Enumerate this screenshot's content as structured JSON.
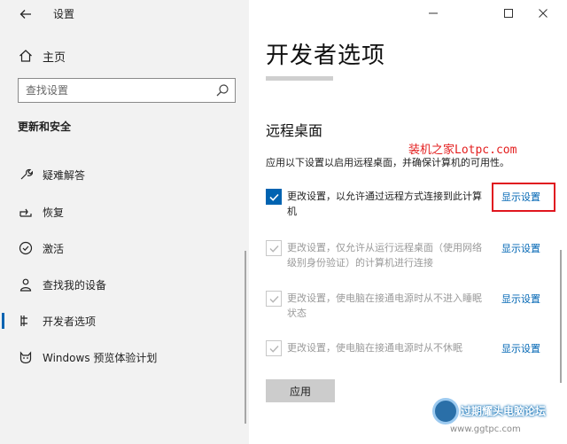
{
  "window": {
    "title": "设置",
    "back_icon": "arrow-left-icon",
    "controls": [
      "minimize-icon",
      "maximize-icon",
      "close-icon"
    ]
  },
  "sidebar": {
    "home_label": "主页",
    "search_placeholder": "查找设置",
    "section_title": "更新和安全",
    "items": [
      {
        "label": "疑难解答",
        "icon": "wrench-icon",
        "active": false
      },
      {
        "label": "恢复",
        "icon": "recovery-icon",
        "active": false
      },
      {
        "label": "激活",
        "icon": "check-circle-icon",
        "active": false
      },
      {
        "label": "查找我的设备",
        "icon": "person-location-icon",
        "active": false
      },
      {
        "label": "开发者选项",
        "icon": "developer-icon",
        "active": true
      },
      {
        "label": "Windows 预览体验计划",
        "icon": "cat-icon",
        "active": false
      }
    ]
  },
  "main": {
    "title": "开发者选项",
    "section_title": "远程桌面",
    "annotation": "装机之家Lotpc.com",
    "description": "应用以下设置以启用远程桌面，并确保计算机的可用性。",
    "options": [
      {
        "text": "更改设置，以允许通过远程方式连接到此计算机",
        "checked": true,
        "disabled": false,
        "link": "显示设置"
      },
      {
        "text": "更改设置，仅允许从运行远程桌面（使用网络级别身份验证）的计算机进行连接",
        "checked": true,
        "disabled": true,
        "link": "显示设置"
      },
      {
        "text": "更改设置，使电脑在接通电源时从不进入睡眠状态",
        "checked": true,
        "disabled": true,
        "link": "显示设置"
      },
      {
        "text": "更改设置，使电脑在接通电源时从不休眠",
        "checked": true,
        "disabled": true,
        "link": "显示设置"
      }
    ],
    "apply_label": "应用"
  },
  "watermark": {
    "line1": "过期耀头电脑论坛",
    "line2": "www.ggtpc.com"
  },
  "colors": {
    "accent": "#0063b1",
    "link": "#0066b4",
    "annotation_red": "#e31d1d"
  }
}
